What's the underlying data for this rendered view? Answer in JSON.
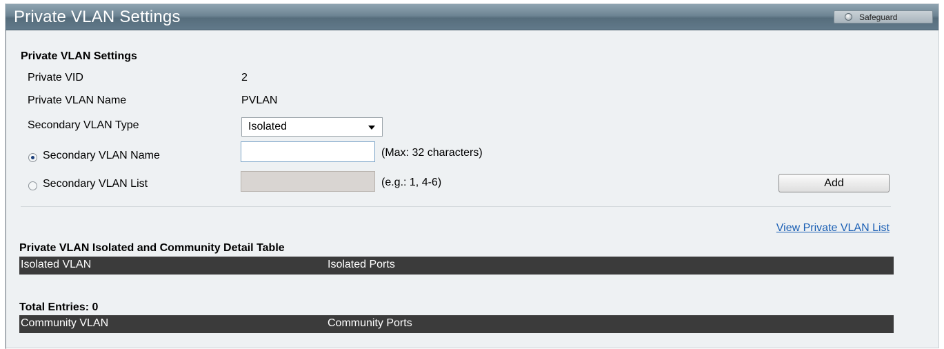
{
  "header": {
    "title": "Private VLAN Settings",
    "safeguard_label": "Safeguard"
  },
  "form": {
    "section_title": "Private VLAN Settings",
    "private_vid_label": "Private VID",
    "private_vid_value": "2",
    "private_vlan_name_label": "Private VLAN Name",
    "private_vlan_name_value": "PVLAN",
    "secondary_type_label": "Secondary VLAN Type",
    "secondary_type_value": "Isolated",
    "secondary_name_label": "Secondary VLAN Name",
    "secondary_name_value": "",
    "secondary_name_hint": "(Max: 32 characters)",
    "secondary_list_label": "Secondary VLAN List",
    "secondary_list_value": "",
    "secondary_list_hint": "(e.g.: 1, 4-6)",
    "selected_radio": "secondary_name",
    "add_button": "Add"
  },
  "link": {
    "view_list": "View Private VLAN List"
  },
  "tables": {
    "detail_title": "Private VLAN Isolated and Community Detail Table",
    "isolated_headers": [
      "Isolated VLAN",
      "Isolated Ports"
    ],
    "total_entries": "Total Entries: 0",
    "community_headers": [
      "Community VLAN",
      "Community Ports"
    ]
  },
  "colors": {
    "title_bar": "#6d8493",
    "background": "#eef1f3",
    "table_header": "#3b3b3b",
    "link": "#1a5fb4"
  }
}
